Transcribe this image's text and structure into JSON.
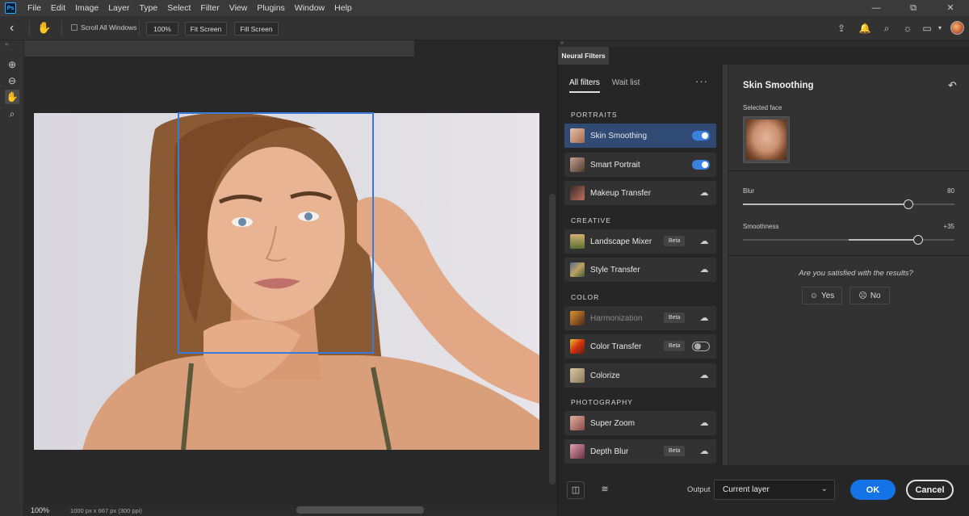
{
  "menubar": {
    "logo": "Ps",
    "items": [
      "File",
      "Edit",
      "Image",
      "Layer",
      "Type",
      "Select",
      "Filter",
      "View",
      "Plugins",
      "Window",
      "Help"
    ],
    "window_controls": [
      "—",
      "⧉",
      "✕"
    ]
  },
  "options_bar": {
    "scroll_all_windows": "Scroll All Windows",
    "zoom_100": "100%",
    "fit_screen": "Fit Screen",
    "fill_screen": "Fill Screen"
  },
  "status": {
    "zoom": "100%",
    "doc_info": "1000 px x 667 px (300 ppi)"
  },
  "neural_filters": {
    "panel_tab": "Neural Filters",
    "tab_all": "All filters",
    "tab_wait": "Wait list",
    "more": "···",
    "sections": {
      "portraits": "PORTRAITS",
      "creative": "CREATIVE",
      "color": "COLOR",
      "photography": "PHOTOGRAPHY"
    },
    "filters": [
      {
        "label": "Skin Smoothing",
        "thumb": "#c8957a"
      },
      {
        "label": "Smart Portrait",
        "thumb": "#8a6a58"
      },
      {
        "label": "Makeup Transfer",
        "thumb": "#9a5a50"
      },
      {
        "label": "Landscape Mixer",
        "badge": "Beta",
        "thumb": "#7a8a50"
      },
      {
        "label": "Style Transfer",
        "thumb": "#6a8aa0"
      },
      {
        "label": "Harmonization",
        "badge": "Beta",
        "thumb": "#a06a30"
      },
      {
        "label": "Color Transfer",
        "badge": "Beta",
        "thumb": "#d04a20"
      },
      {
        "label": "Colorize",
        "thumb": "#b0a080"
      },
      {
        "label": "Super Zoom",
        "thumb": "#b07a70"
      },
      {
        "label": "Depth Blur",
        "badge": "Beta",
        "thumb": "#9a5a70"
      }
    ]
  },
  "settings": {
    "title": "Skin Smoothing",
    "selected_face": "Selected face",
    "blur_label": "Blur",
    "blur_value": "80",
    "smooth_label": "Smoothness",
    "smooth_value": "+35",
    "feedback_q": "Are you satisfied with the results?",
    "yes": "Yes",
    "no": "No"
  },
  "footer": {
    "output_label": "Output",
    "output_value": "Current layer",
    "ok": "OK",
    "cancel": "Cancel"
  },
  "accent_color": "#1473e6",
  "selection_color": "#2f4b74"
}
